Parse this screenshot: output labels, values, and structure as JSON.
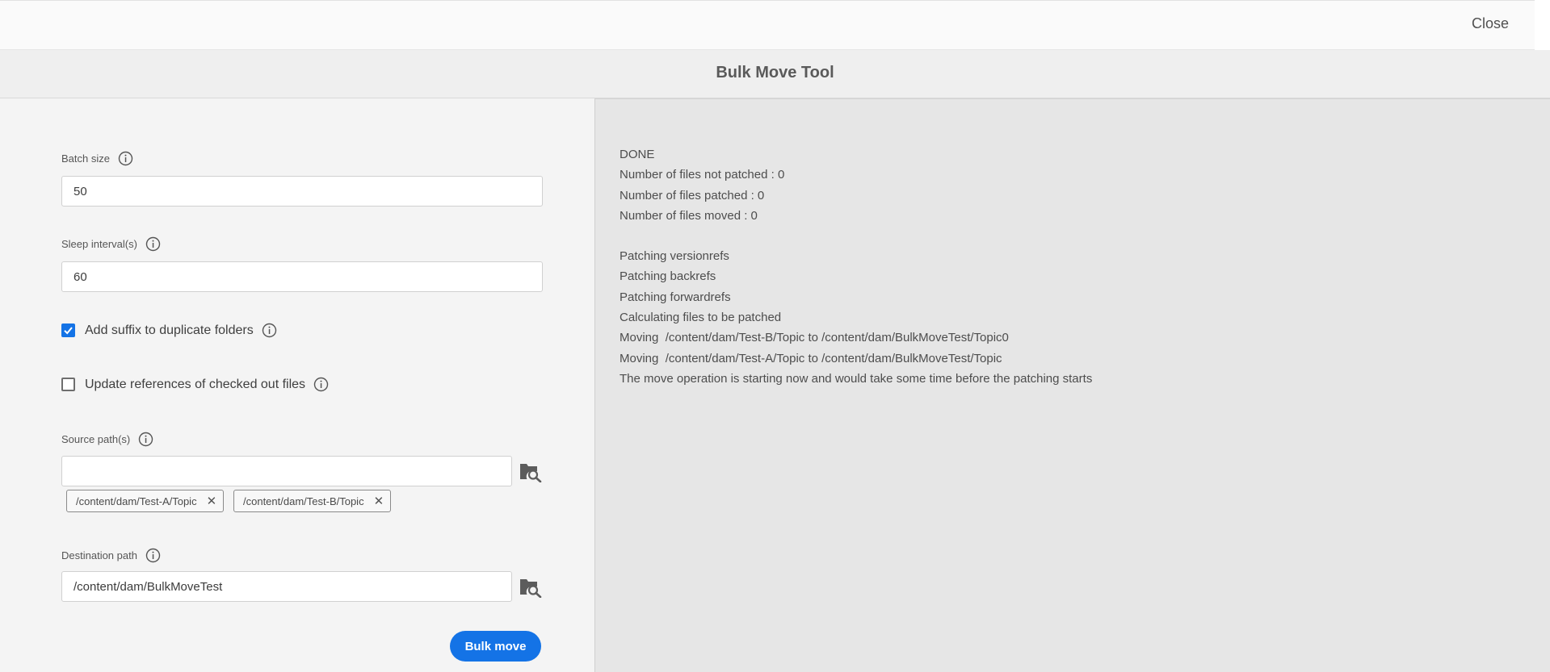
{
  "header": {
    "close_label": "Close"
  },
  "title": "Bulk Move Tool",
  "form": {
    "batch_size": {
      "label": "Batch size",
      "value": "50"
    },
    "sleep_interval": {
      "label": "Sleep interval(s)",
      "value": "60"
    },
    "add_suffix": {
      "label": "Add suffix to duplicate folders",
      "checked": true
    },
    "update_refs": {
      "label": "Update references of checked out files",
      "checked": false
    },
    "source": {
      "label": "Source path(s)",
      "value": "",
      "tags": [
        "/content/dam/Test-A/Topic",
        "/content/dam/Test-B/Topic"
      ]
    },
    "destination": {
      "label": "Destination path",
      "value": "/content/dam/BulkMoveTest"
    },
    "submit_label": "Bulk move"
  },
  "log": {
    "lines": [
      "DONE",
      "Number of files not patched : 0",
      "Number of files patched : 0",
      "Number of files moved : 0",
      "",
      "Patching versionrefs",
      "Patching backrefs",
      "Patching forwardrefs",
      "Calculating files to be patched",
      "Moving  /content/dam/Test-B/Topic to /content/dam/BulkMoveTest/Topic0",
      "Moving  /content/dam/Test-A/Topic to /content/dam/BulkMoveTest/Topic",
      "The move operation is starting now and would take some time before the patching starts"
    ]
  },
  "colors": {
    "accent": "#1473e6",
    "left_bg": "#f4f4f4",
    "right_bg": "#e6e6e6"
  },
  "icons": {
    "info": "info-icon",
    "folder_search": "folder-search-icon",
    "check": "check-icon",
    "remove": "close-icon"
  }
}
